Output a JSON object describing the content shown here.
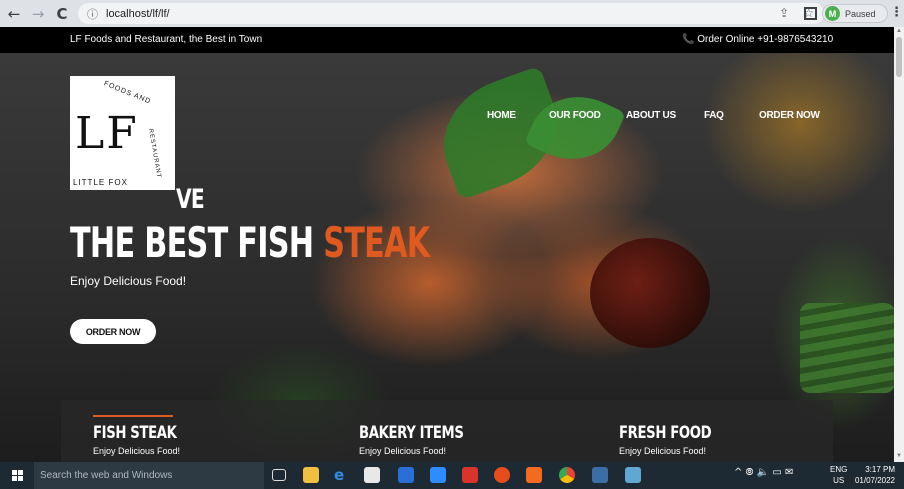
{
  "browser": {
    "url": "localhost/lf/lf/",
    "profile_initial": "M",
    "profile_status": "Paused",
    "back_icon": "←",
    "forward_icon": "→",
    "reload_icon": "C",
    "info_icon": "ⓘ",
    "share_icon": "⇪",
    "star_icon": "☆",
    "menu_icon": "⋮"
  },
  "topbar": {
    "tagline": "LF Foods and Restaurant, the Best in Town",
    "order": "📞 Order Online +91-9876543210"
  },
  "logo": {
    "lf": "LF",
    "arc_top": "FOODS AND",
    "arc_side": "RESTAURANT",
    "little": "LITTLE FOX"
  },
  "nav": {
    "items": [
      "HOME",
      "OUR FOOD",
      "ABOUT US",
      "FAQ",
      "ORDER NOW"
    ]
  },
  "hero": {
    "line1": "VE",
    "line2_main": "THE BEST FISH ",
    "line2_accent": "STEAK",
    "subtitle": "Enjoy Delicious Food!",
    "button": "ORDER NOW"
  },
  "features": [
    {
      "title": "FISH STEAK",
      "sub": "Enjoy Delicious Food!"
    },
    {
      "title": "BAKERY ITEMS",
      "sub": "Enjoy Delicious Food!"
    },
    {
      "title": "FRESH FOOD",
      "sub": "Enjoy Delicious Food!"
    }
  ],
  "taskbar": {
    "search_placeholder": "Search the web and Windows",
    "tray": "^ ⦾ 🔈 ▭ ✉",
    "lang_top": "ENG",
    "lang_bottom": "US",
    "time": "3:17 PM",
    "date": "01/07/2022"
  },
  "colors": {
    "accent": "#e0591e",
    "topbar": "#000000",
    "taskbar": "#1e2a33"
  }
}
